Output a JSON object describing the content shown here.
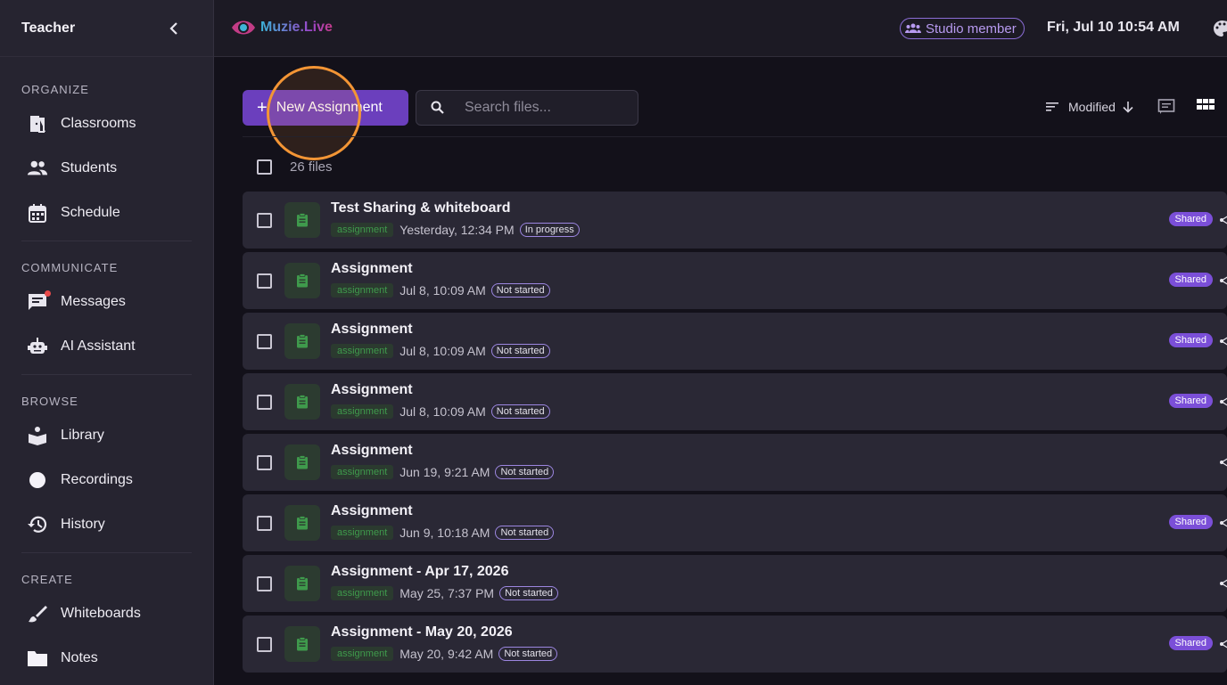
{
  "sidebar": {
    "title": "Teacher",
    "sections": [
      {
        "title": "ORGANIZE",
        "items": [
          {
            "label": "Classrooms",
            "icon": "door-icon"
          },
          {
            "label": "Students",
            "icon": "people-icon"
          },
          {
            "label": "Schedule",
            "icon": "calendar-icon"
          }
        ]
      },
      {
        "title": "COMMUNICATE",
        "items": [
          {
            "label": "Messages",
            "icon": "message-icon"
          },
          {
            "label": "AI Assistant",
            "icon": "robot-icon"
          }
        ]
      },
      {
        "title": "BROWSE",
        "items": [
          {
            "label": "Library",
            "icon": "book-icon"
          },
          {
            "label": "Recordings",
            "icon": "record-icon"
          },
          {
            "label": "History",
            "icon": "history-icon"
          }
        ]
      },
      {
        "title": "CREATE",
        "items": [
          {
            "label": "Whiteboards",
            "icon": "brush-icon"
          },
          {
            "label": "Notes",
            "icon": "folder-icon"
          }
        ]
      }
    ]
  },
  "topbar": {
    "logo": "Muzie.Live",
    "studio_badge": "Studio member",
    "datetime": "Fri, Jul 10 10:54 AM"
  },
  "toolbar": {
    "new_button": "New Assignment",
    "search_placeholder": "Search files...",
    "sort_label": "Modified",
    "file_count": "26 files"
  },
  "files": [
    {
      "title": "Test Sharing & whiteboard",
      "tag": "assignment",
      "date": "Yesterday, 12:34 PM",
      "status": "In progress",
      "shared": "Shared"
    },
    {
      "title": "Assignment",
      "tag": "assignment",
      "date": "Jul 8, 10:09 AM",
      "status": "Not started",
      "shared": "Shared"
    },
    {
      "title": "Assignment",
      "tag": "assignment",
      "date": "Jul 8, 10:09 AM",
      "status": "Not started",
      "shared": "Shared"
    },
    {
      "title": "Assignment",
      "tag": "assignment",
      "date": "Jul 8, 10:09 AM",
      "status": "Not started",
      "shared": "Shared"
    },
    {
      "title": "Assignment",
      "tag": "assignment",
      "date": "Jun 19, 9:21 AM",
      "status": "Not started",
      "shared": ""
    },
    {
      "title": "Assignment",
      "tag": "assignment",
      "date": "Jun 9, 10:18 AM",
      "status": "Not started",
      "shared": "Shared"
    },
    {
      "title": "Assignment - Apr 17, 2026",
      "tag": "assignment",
      "date": "May 25, 7:37 PM",
      "status": "Not started",
      "shared": ""
    },
    {
      "title": "Assignment - May 20, 2026",
      "tag": "assignment",
      "date": "May 20, 9:42 AM",
      "status": "Not started",
      "shared": "Shared"
    }
  ]
}
